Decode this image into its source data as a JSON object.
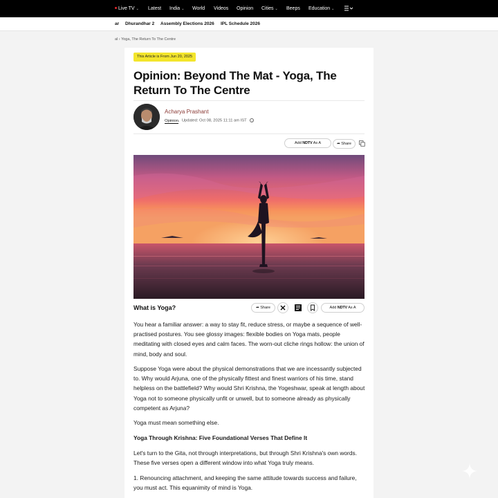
{
  "topnav": {
    "live_tv": "Live TV",
    "latest": "Latest",
    "india": "India",
    "world": "World",
    "videos": "Videos",
    "opinion": "Opinion",
    "cities": "Cities",
    "beeps": "Beeps",
    "education": "Education",
    "menu_icon": "menu-icon"
  },
  "subnav": {
    "items": [
      "ar",
      "Dhurandhar 2",
      "Assembly Elections 2026",
      "IPL Schedule 2026"
    ]
  },
  "breadcrumb": "al › Yoga, The Return To The Centre",
  "article": {
    "badge": "This Article is From Jun 20, 2025",
    "title": "Opinion: Beyond The Mat - Yoga, The Return To The Centre",
    "author": "Acharya Prashant",
    "category": "Opinion",
    "updated": "Updated: Oct 08, 2025 11:11 am IST",
    "add_ndtv_prefix": "Add",
    "add_ndtv_brand": "NDTV",
    "add_ndtv_suffix": "As A",
    "share": "Share",
    "section_heading": "What is Yoga?",
    "paragraphs": [
      "You hear a familiar answer: a way to stay fit, reduce stress, or maybe a sequence of well-practised postures. You see glossy images: flexible bodies on Yoga mats, people meditating with closed eyes and calm faces. The worn-out cliche rings hollow: the union of mind, body and soul.",
      "Suppose Yoga were about the physical demonstrations that we are incessantly subjected to. Why would Arjuna, one of the physically fittest and finest warriors of his time, stand helpless on the battlefield? Why would Shri Krishna, the Yogeshwar, speak at length about Yoga not to someone physically unfit or unwell, but to someone already as physically competent as Arjuna?",
      "Yoga must mean something else.",
      "Yoga Through Krishna: Five Foundational Verses That Define It",
      "Let's turn to the Gita, not through interpretations, but through Shri Krishna's own words. These five verses open a different window into what Yoga truly means.",
      "1. Renouncing attachment, and keeping the same attitude towards success and failure, you must act. This equanimity of mind is Yoga."
    ]
  },
  "colors": {
    "nav_bg": "#000000",
    "badge_bg": "#f3e52c",
    "author": "#8a3a35",
    "live_dot": "#e5262a"
  }
}
